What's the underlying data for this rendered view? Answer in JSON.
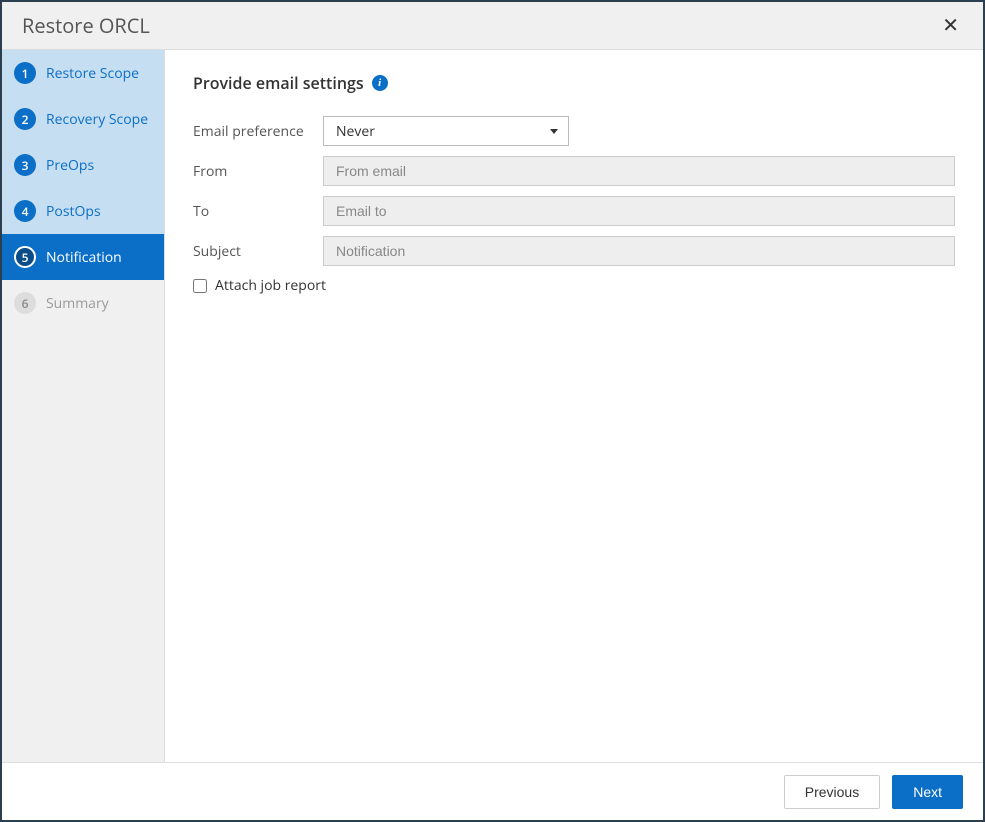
{
  "modal": {
    "title": "Restore ORCL"
  },
  "sidebar": {
    "steps": [
      {
        "num": "1",
        "label": "Restore Scope",
        "state": "completed"
      },
      {
        "num": "2",
        "label": "Recovery Scope",
        "state": "completed"
      },
      {
        "num": "3",
        "label": "PreOps",
        "state": "completed"
      },
      {
        "num": "4",
        "label": "PostOps",
        "state": "completed"
      },
      {
        "num": "5",
        "label": "Notification",
        "state": "active"
      },
      {
        "num": "6",
        "label": "Summary",
        "state": "pending"
      }
    ]
  },
  "content": {
    "title": "Provide email settings",
    "email_preference_label": "Email preference",
    "email_preference_value": "Never",
    "from_label": "From",
    "from_placeholder": "From email",
    "from_value": "",
    "to_label": "To",
    "to_placeholder": "Email to",
    "to_value": "",
    "subject_label": "Subject",
    "subject_placeholder": "Notification",
    "subject_value": "",
    "attach_label": "Attach job report",
    "attach_checked": false
  },
  "footer": {
    "previous": "Previous",
    "next": "Next"
  }
}
